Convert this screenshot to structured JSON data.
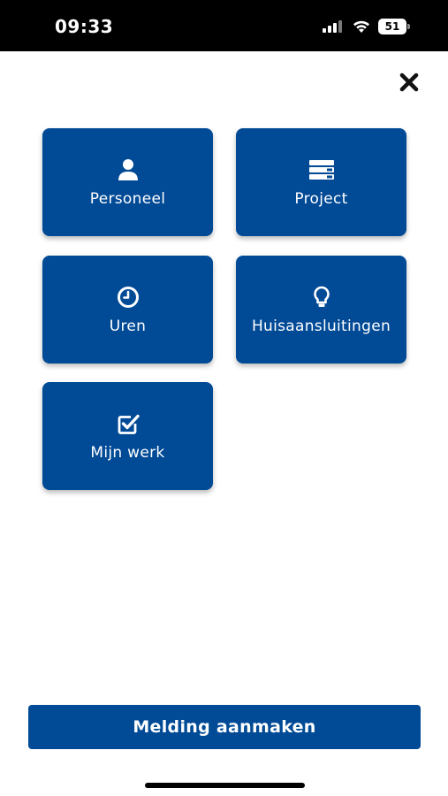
{
  "status_bar": {
    "time": "09:33",
    "battery_level": "51",
    "icons": [
      "signal-icon",
      "wifi-icon",
      "battery-icon"
    ]
  },
  "close": {
    "icon": "close-icon"
  },
  "menu": {
    "tiles": [
      {
        "label": "Personeel",
        "icon": "person-icon"
      },
      {
        "label": "Project",
        "icon": "server-icon"
      },
      {
        "label": "Uren",
        "icon": "clock-icon"
      },
      {
        "label": "Huisaansluitingen",
        "icon": "lightbulb-icon"
      },
      {
        "label": "Mijn werk",
        "icon": "checkbox-icon"
      }
    ]
  },
  "footer": {
    "primary_button_label": "Melding aanmaken"
  },
  "colors": {
    "primary": "#004a96",
    "status_bar": "#000000",
    "background": "#ffffff"
  }
}
